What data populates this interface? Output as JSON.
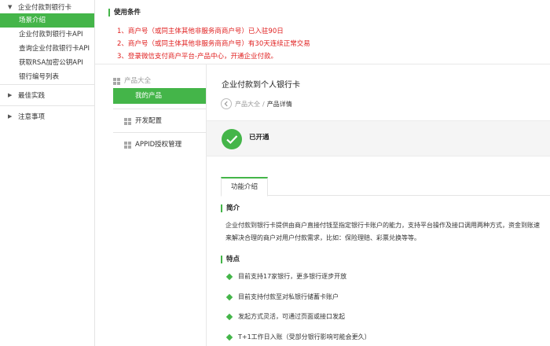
{
  "sidebar": {
    "groups": [
      {
        "label": "企业付款到银行卡",
        "expanded": true,
        "items": [
          "场景介绍",
          "企业付款到银行卡API",
          "查询企业付款银行卡API",
          "获取RSA加密公钥API",
          "银行编号列表"
        ]
      },
      {
        "label": "最佳实践",
        "expanded": false
      },
      {
        "label": "注意事项",
        "expanded": false
      }
    ],
    "active_item": "场景介绍"
  },
  "conditions": {
    "title": "使用条件",
    "items": [
      "1、商户号（或同主体其他非服务商商户号）已入驻90日",
      "2、商户号（或同主体其他非服务商商户号）有30天连续正常交易",
      "3、登录微信支付商户平台-产品中心，开通企业付款。"
    ]
  },
  "product_nav": {
    "header": "产品大全",
    "items": [
      "我的产品",
      "开发配置",
      "APPID授权管理"
    ]
  },
  "panel": {
    "title": "企业付款到个人银行卡",
    "breadcrumb": {
      "parent": "产品大全",
      "separator": "/",
      "current": "产品详情"
    },
    "status": "已开通",
    "tab": "功能介绍",
    "intro_title": "简介",
    "intro_lines": [
      "企业付款到银行卡提供由商户直接付钱至指定银行卡账户的能力，支持平台操作及接口调用两种方式，资金到账速",
      "来解决合理的商户对用户付款需求，比如：保险理赔、彩票兑换等等。"
    ],
    "features_title": "特点",
    "features": [
      "目前支持17家银行，更多银行逐步开放",
      "目前支持付款至对私银行储蓄卡账户",
      "发起方式灵活，可通过页面或接口发起",
      "T+1工作日入账（受部分银行影响可能会更久）"
    ]
  },
  "colors": {
    "accent": "#44b549",
    "warning": "#e02020"
  }
}
